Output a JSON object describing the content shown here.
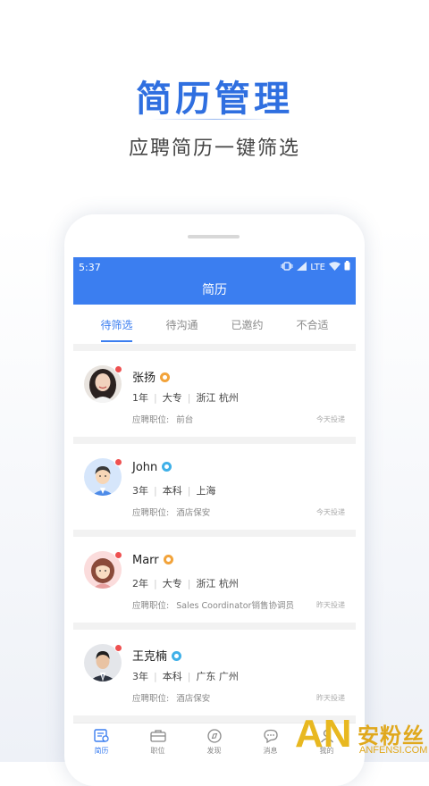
{
  "promo": {
    "headline": "简历管理",
    "subheadline": "应聘简历一键筛选"
  },
  "status_bar": {
    "time": "5:37",
    "network": "LTE"
  },
  "app": {
    "title": "简历"
  },
  "tabs": [
    {
      "label": "待筛选",
      "active": true
    },
    {
      "label": "待沟通",
      "active": false
    },
    {
      "label": "已邀约",
      "active": false
    },
    {
      "label": "不合适",
      "active": false
    }
  ],
  "position_label": "应聘职位:",
  "candidates": [
    {
      "name": "张扬",
      "badge_color": "orange",
      "years": "1年",
      "education": "大专",
      "location": "浙江 杭州",
      "position": "前台",
      "when": "今天投递",
      "avatar": "woman-avatar"
    },
    {
      "name": "John",
      "badge_color": "blue",
      "years": "3年",
      "education": "本科",
      "location": "上海",
      "position": "酒店保安",
      "when": "今天投递",
      "avatar": "man-cartoon-avatar"
    },
    {
      "name": "Marr",
      "badge_color": "orange",
      "years": "2年",
      "education": "大专",
      "location": "浙江 杭州",
      "position": "Sales Coordinator销售协调员",
      "when": "昨天投递",
      "avatar": "woman-cartoon-avatar"
    },
    {
      "name": "王克楠",
      "badge_color": "blue",
      "years": "3年",
      "education": "本科",
      "location": "广东 广州",
      "position": "酒店保安",
      "when": "昨天投递",
      "avatar": "man-avatar"
    }
  ],
  "bottom_nav": [
    {
      "label": "简历",
      "icon": "resume-icon",
      "active": true
    },
    {
      "label": "职位",
      "icon": "briefcase-icon",
      "active": false
    },
    {
      "label": "发现",
      "icon": "compass-icon",
      "active": false
    },
    {
      "label": "消息",
      "icon": "message-icon",
      "active": false
    },
    {
      "label": "我的",
      "icon": "person-icon",
      "active": false
    }
  ],
  "watermark": {
    "logo": "AN",
    "cn": "安粉丝",
    "en": "ANFENSI.COM"
  },
  "colors": {
    "brand_blue": "#3b7ef0",
    "headline_blue": "#2f6fe0",
    "badge_orange": "#f2a33a",
    "badge_blue": "#3fb0e8",
    "unread_dot": "#ee5050",
    "watermark_gold": "#e0a81c"
  }
}
